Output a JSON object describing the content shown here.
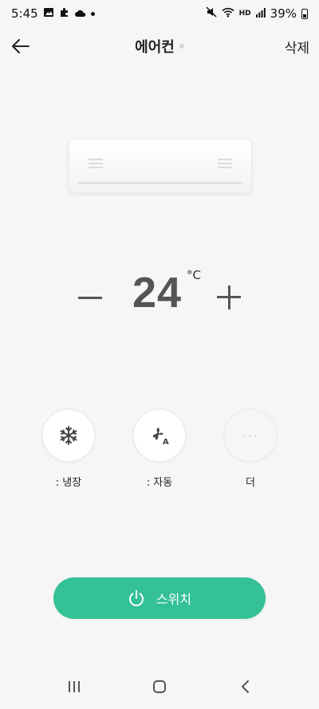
{
  "status_bar": {
    "time": "5:45",
    "battery": "39%",
    "hd_label": "HD",
    "icons": [
      "gallery-icon",
      "puzzle-icon",
      "cloud-icon",
      "dot-icon",
      "mute-icon",
      "wifi-icon",
      "hd-voice-icon",
      "signal-icon",
      "battery-icon"
    ]
  },
  "header": {
    "title": "에어컨",
    "delete_label": "삭제",
    "back_icon": "arrow-left-icon"
  },
  "temperature": {
    "value": "24",
    "unit": "°C",
    "minus_icon": "minus-icon",
    "plus_icon": "plus-icon"
  },
  "modes": [
    {
      "label": ": 냉장",
      "icon": "snowflake-icon"
    },
    {
      "label": ": 자동",
      "icon": "fan-auto-icon"
    },
    {
      "label": "더",
      "icon": "more-dots-icon"
    }
  ],
  "switch_button": {
    "label": "스위치",
    "icon": "power-icon",
    "color": "#33c195"
  },
  "nav_bar": {
    "icons": [
      "recent-apps-icon",
      "home-icon",
      "back-icon"
    ]
  }
}
